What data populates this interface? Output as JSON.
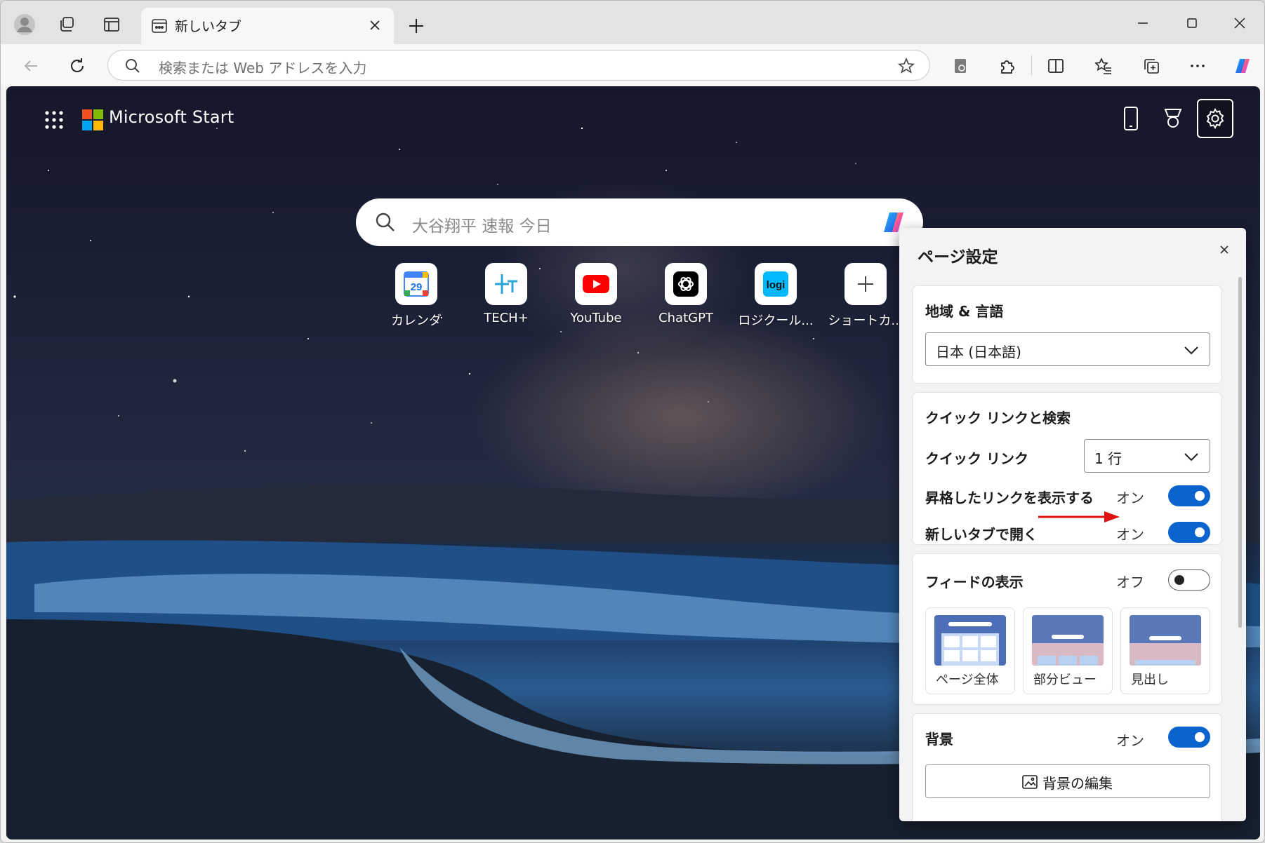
{
  "browser": {
    "tab": {
      "title": "新しいタブ"
    },
    "address_bar": {
      "placeholder": "検索または Web アドレスを入力"
    }
  },
  "page": {
    "brand": "Microsoft Start",
    "search": {
      "placeholder": "大谷翔平 速報 今日"
    },
    "quick_links": [
      {
        "label": "カレンダ",
        "icon": "google-calendar-icon",
        "badge": "29"
      },
      {
        "label": "TECH+",
        "icon": "techplus-icon"
      },
      {
        "label": "YouTube",
        "icon": "youtube-icon"
      },
      {
        "label": "ChatGPT",
        "icon": "chatgpt-icon"
      },
      {
        "label": "ロジクール...",
        "icon": "logi-icon",
        "badge": "logi"
      },
      {
        "label": "ショートカ...",
        "icon": "plus-icon"
      }
    ]
  },
  "settings_panel": {
    "title": "ページ設定",
    "region": {
      "heading": "地域 & 言語",
      "selected": "日本 (日本語)"
    },
    "quick_links_section": {
      "heading": "クイック リンクと検索",
      "quick_links_label": "クイック リンク",
      "quick_links_rows": "1 行",
      "promoted_label": "昇格したリンクを表示する",
      "promoted_state": "オン",
      "new_tab_label": "新しいタブで開く",
      "new_tab_state": "オン"
    },
    "feed": {
      "heading": "フィードの表示",
      "state": "オフ",
      "layouts": [
        {
          "label": "ページ全体"
        },
        {
          "label": "部分ビュー"
        },
        {
          "label": "見出し"
        }
      ]
    },
    "background": {
      "heading": "背景",
      "state": "オン",
      "edit_label": "背景の編集"
    }
  },
  "colors": {
    "accent": "#0b63ce",
    "annotation_arrow": "#e01010"
  }
}
